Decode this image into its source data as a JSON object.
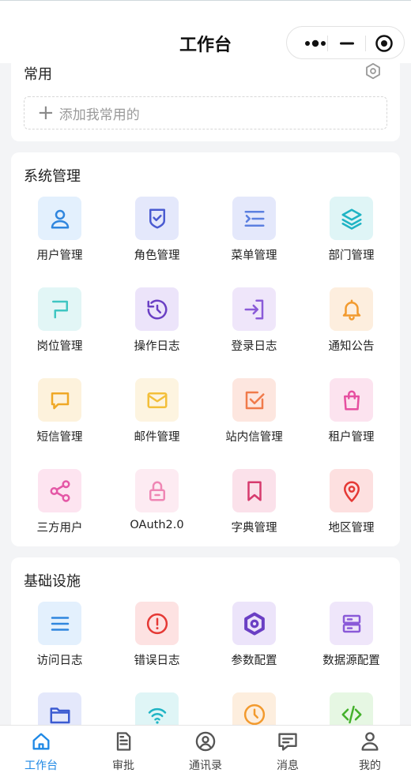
{
  "header": {
    "title": "工作台"
  },
  "common": {
    "title": "常用",
    "add_label": "添加我常用的"
  },
  "system": {
    "title": "系统管理",
    "items": [
      {
        "label": "用户管理",
        "icon": "user-icon",
        "bg": "#e3f0fd",
        "fg": "#2f86de"
      },
      {
        "label": "角色管理",
        "icon": "shield-check-icon",
        "bg": "#e4e8fb",
        "fg": "#4a5bd1"
      },
      {
        "label": "菜单管理",
        "icon": "menu-list-icon",
        "bg": "#e4e8fb",
        "fg": "#5b7fe0"
      },
      {
        "label": "部门管理",
        "icon": "layers-icon",
        "bg": "#dff5f6",
        "fg": "#1fb4c4"
      },
      {
        "label": "岗位管理",
        "icon": "post-icon",
        "bg": "#e2f6f6",
        "fg": "#3fc6c2"
      },
      {
        "label": "操作日志",
        "icon": "history-icon",
        "bg": "#ece4fa",
        "fg": "#6a3fc4"
      },
      {
        "label": "登录日志",
        "icon": "login-icon",
        "bg": "#efe6fa",
        "fg": "#8a5ad8"
      },
      {
        "label": "通知公告",
        "icon": "bell-icon",
        "bg": "#fdeede",
        "fg": "#f29a2e"
      },
      {
        "label": "短信管理",
        "icon": "message-icon",
        "bg": "#fdf2dc",
        "fg": "#efa826"
      },
      {
        "label": "邮件管理",
        "icon": "mail-icon",
        "bg": "#fdf4e0",
        "fg": "#f3bf3a"
      },
      {
        "label": "站内信管理",
        "icon": "checkbox-icon",
        "bg": "#fde6df",
        "fg": "#f07a4a"
      },
      {
        "label": "租户管理",
        "icon": "shopping-bag-icon",
        "bg": "#fce3ef",
        "fg": "#e64fa0"
      },
      {
        "label": "三方用户",
        "icon": "share-icon",
        "bg": "#fde4f0",
        "fg": "#e457a6"
      },
      {
        "label": "OAuth2.0",
        "icon": "lock-icon",
        "bg": "#fdebf2",
        "fg": "#ef86b4"
      },
      {
        "label": "字典管理",
        "icon": "bookmark-icon",
        "bg": "#fbe1ea",
        "fg": "#d63b6e"
      },
      {
        "label": "地区管理",
        "icon": "map-pin-icon",
        "bg": "#fde0e0",
        "fg": "#e53935"
      }
    ]
  },
  "infra": {
    "title": "基础设施",
    "items": [
      {
        "label": "访问日志",
        "icon": "list-icon",
        "bg": "#e3f0fd",
        "fg": "#2f86de"
      },
      {
        "label": "错误日志",
        "icon": "alert-circle-icon",
        "bg": "#fde2e2",
        "fg": "#e53935"
      },
      {
        "label": "参数配置",
        "icon": "hexagon-settings-icon",
        "bg": "#ece4fa",
        "fg": "#6a3fc4"
      },
      {
        "label": "数据源配置",
        "icon": "server-icon",
        "bg": "#efe6fa",
        "fg": "#8a5ad8"
      },
      {
        "label": "",
        "icon": "folder-icon",
        "bg": "#e4e8fb",
        "fg": "#3b5bd1"
      },
      {
        "label": "",
        "icon": "wifi-icon",
        "bg": "#dff5f6",
        "fg": "#1fb4c4"
      },
      {
        "label": "",
        "icon": "clock-icon",
        "bg": "#fdeede",
        "fg": "#f29a2e"
      },
      {
        "label": "",
        "icon": "code-icon",
        "bg": "#e6f7e3",
        "fg": "#43b02a"
      }
    ]
  },
  "tabs": [
    {
      "label": "工作台",
      "icon": "home-icon",
      "active": true
    },
    {
      "label": "审批",
      "icon": "document-icon",
      "active": false
    },
    {
      "label": "通讯录",
      "icon": "contact-icon",
      "active": false
    },
    {
      "label": "消息",
      "icon": "chat-icon",
      "active": false
    },
    {
      "label": "我的",
      "icon": "profile-icon",
      "active": false
    }
  ],
  "colors": {
    "accent": "#1e88e5",
    "tab_inactive": "#555555"
  }
}
